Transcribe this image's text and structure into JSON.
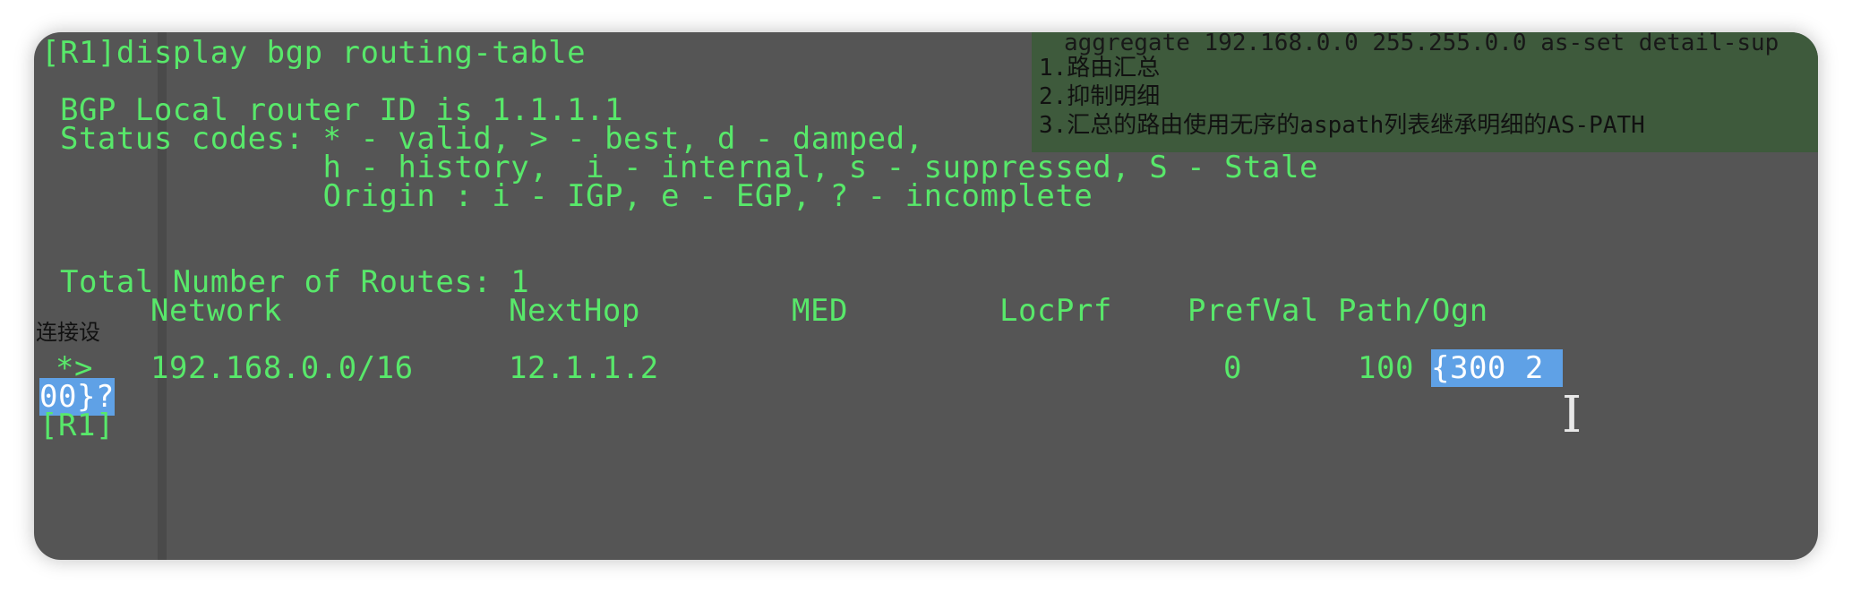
{
  "terminal": {
    "command": "[R1]display bgp routing-table",
    "router_id_line": " BGP Local router ID is 1.1.1.1",
    "status_line1": " Status codes: * - valid, > - best, d - damped,",
    "status_line2": "               h - history,  i - internal, s - suppressed, S - Stale",
    "origin_line": "               Origin : i - IGP, e - EGP, ? - incomplete",
    "total_routes": " Total Number of Routes: 1",
    "headers": {
      "network": "Network",
      "nexthop": "NextHop",
      "med": "MED",
      "locprf": "LocPrf",
      "prefval": "PrefVal",
      "path": "Path/Ogn"
    },
    "route": {
      "status": "*>",
      "network": "192.168.0.0/16",
      "nexthop": "12.1.1.2",
      "locprf": "0",
      "prefval": "100",
      "path_part1": "{300 2 ",
      "path_part2": "00}?"
    },
    "prompt": "[R1]"
  },
  "note": {
    "line0": "aggregate 192.168.0.0 255.255.0.0 as-set detail-sup",
    "line1": "1.路由汇总",
    "line2": "2.抑制明细",
    "line3": "3.汇总的路由使用无序的aspath列表继承明细的AS-PATH"
  },
  "side_label": "连接设",
  "colors": {
    "terminal_bg": "#555555",
    "terminal_text": "#58e86a",
    "selection": "#5fa1e6",
    "note_bg": "#3e5a3c"
  },
  "cursor_icon": "i-beam-cursor-icon"
}
